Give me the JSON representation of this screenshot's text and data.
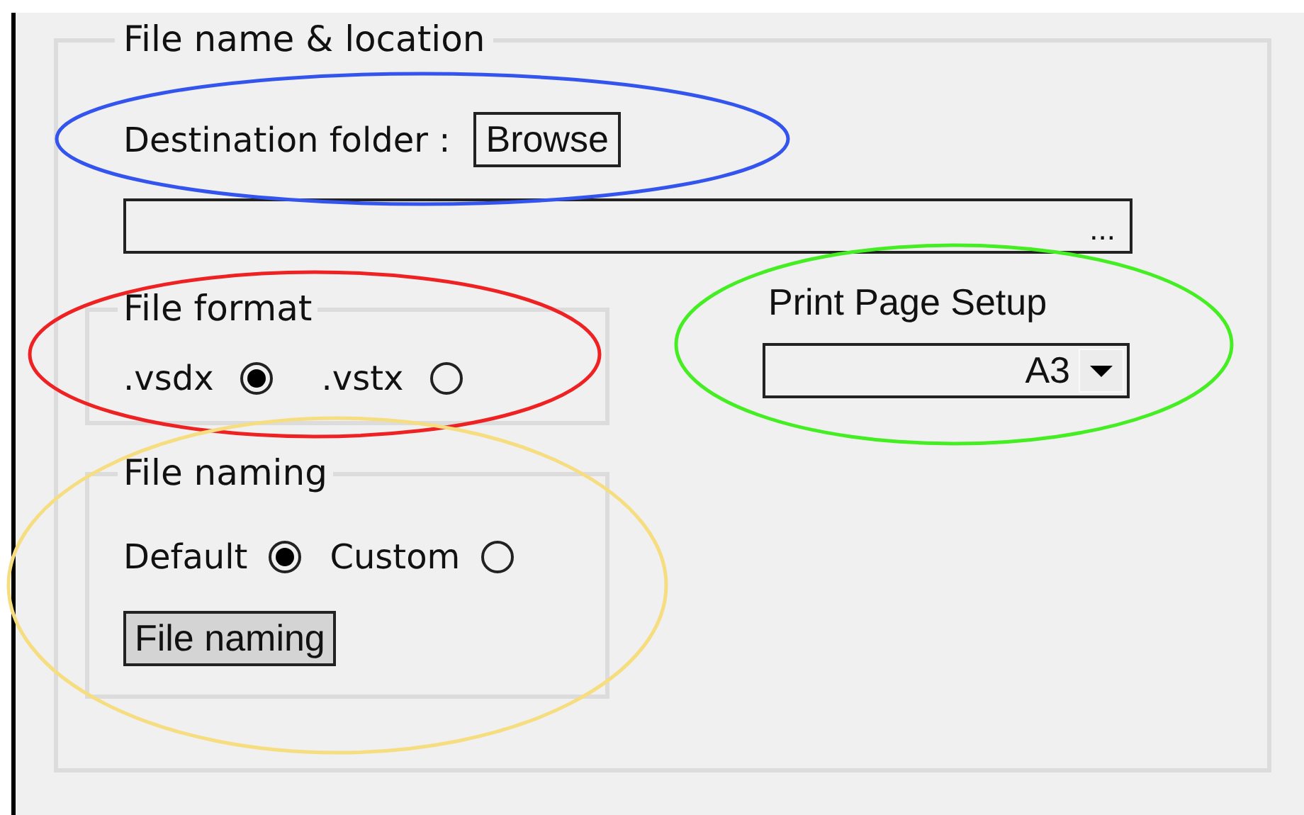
{
  "group": {
    "title": "File name & location"
  },
  "destination": {
    "label": "Destination folder :",
    "button": "Browse",
    "path_field": {
      "suffix": "..."
    }
  },
  "file_format": {
    "title": "File format",
    "options": [
      {
        "label": ".vsdx",
        "selected": true
      },
      {
        "label": ".vstx",
        "selected": false
      }
    ]
  },
  "print_page_setup": {
    "label": "Print Page Setup",
    "value": "A3"
  },
  "file_naming": {
    "title": "File naming",
    "options": [
      {
        "label": "Default",
        "selected": true
      },
      {
        "label": "Custom",
        "selected": false
      }
    ],
    "button": "File naming"
  },
  "annotations": [
    {
      "color": "#3355ee"
    },
    {
      "color": "#ee2222"
    },
    {
      "color": "#44ee22"
    },
    {
      "color": "#f5dd80"
    }
  ]
}
